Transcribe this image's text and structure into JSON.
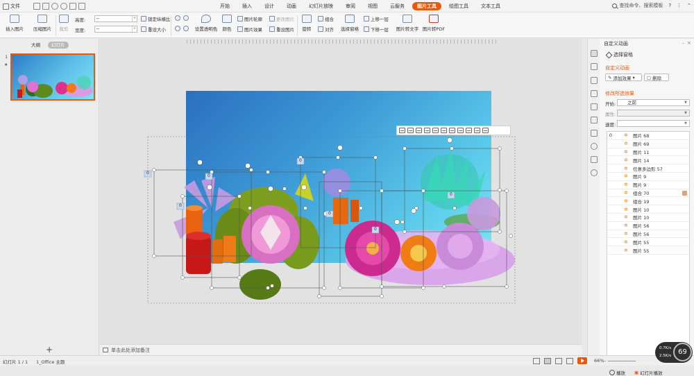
{
  "menubar": {
    "file_label": "文件",
    "tabs": [
      "开始",
      "插入",
      "设计",
      "动画",
      "幻灯片放映",
      "审阅",
      "视图",
      "云服务",
      "图片工具",
      "绘图工具",
      "文本工具"
    ],
    "active_tab": "图片工具",
    "search_cmd": "查找命令、搜索模板"
  },
  "ribbon": {
    "insert_image": "插入图片",
    "compress": "压缩图片",
    "crop": "裁剪",
    "height_label": "高度:",
    "width_label": "宽度:",
    "height_value": "",
    "width_value": "",
    "lock_ratio": "锁定纵横比",
    "reset_size": "重设大小",
    "transparent": "设置透明色",
    "color": "颜色",
    "image_outline": "图片轮廓",
    "image_effect": "图片效果",
    "change_image": "更改图片",
    "reset_image": "重设图片",
    "rotate": "旋转",
    "group": "组合",
    "align": "对齐",
    "selection_pane": "选择窗格",
    "bring_forward": "上移一层",
    "send_backward": "下移一层",
    "image_to_text": "图片转文字",
    "image_to_pdf": "图片转PDF"
  },
  "leftpanel": {
    "tab_outline": "大纲",
    "tab_slides": "幻灯片",
    "slide_number": "1",
    "star": "★",
    "add_slide": "+"
  },
  "canvas": {
    "notes_placeholder": "单击此处添加备注",
    "anim_badge": "0",
    "colors": {
      "slide_top": "#2a6fbf",
      "slide_bottom": "#79e7f5",
      "accent": "#e8580e"
    }
  },
  "anipane": {
    "title": "自定义动画",
    "select_pane": "选择窗格",
    "custom_anim_header": "自定义动画",
    "add_effect": "添加效果",
    "delete": "删除",
    "modify_header": "修改所选效果",
    "start_label": "开始:",
    "start_value": "之前",
    "property_label": "属性:",
    "property_value": "",
    "speed_label": "速度:",
    "speed_value": "",
    "items": [
      {
        "order": "0",
        "name": "图片 68"
      },
      {
        "order": "",
        "name": "图片 69"
      },
      {
        "order": "",
        "name": "图片 11"
      },
      {
        "order": "",
        "name": "图片 14"
      },
      {
        "order": "",
        "name": "任意多边形 57"
      },
      {
        "order": "",
        "name": "图片 9"
      },
      {
        "order": "",
        "name": "图片 9"
      },
      {
        "order": "",
        "name": "组合 70"
      },
      {
        "order": "",
        "name": "组合 19"
      },
      {
        "order": "",
        "name": "图片 10"
      },
      {
        "order": "",
        "name": "图片 10"
      },
      {
        "order": "",
        "name": "图片 56"
      },
      {
        "order": "",
        "name": "图片 56"
      },
      {
        "order": "",
        "name": "图片 55"
      },
      {
        "order": "",
        "name": "图片 55"
      }
    ],
    "play": "播放",
    "slideshow": "幻灯片播放"
  },
  "status": {
    "slide_info": "幻灯片 1 / 1",
    "theme": "1_Office 主题",
    "zoom": "66%",
    "zoom_minus": "–",
    "perf_up": "0.7K/s",
    "perf_down": "2.5K/s",
    "perf_value": "69"
  }
}
